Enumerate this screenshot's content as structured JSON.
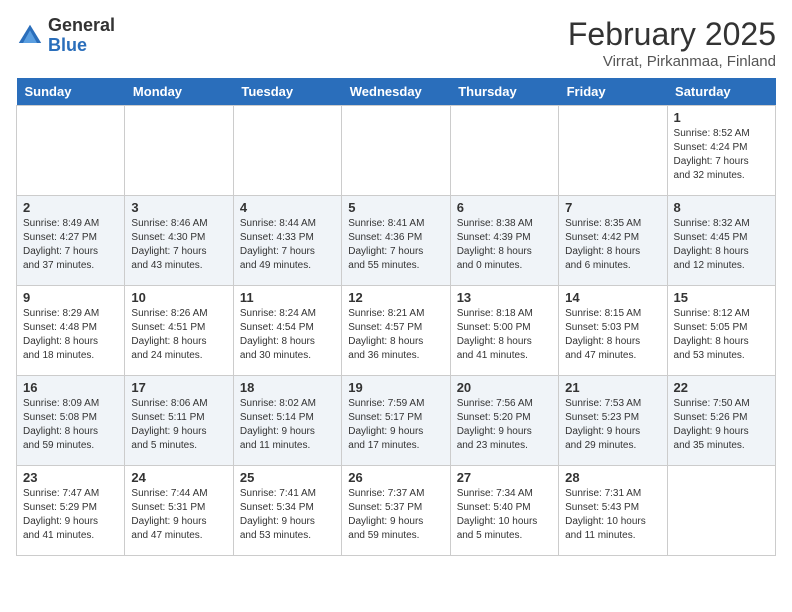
{
  "header": {
    "logo_general": "General",
    "logo_blue": "Blue",
    "title": "February 2025",
    "subtitle": "Virrat, Pirkanmaa, Finland"
  },
  "days_of_week": [
    "Sunday",
    "Monday",
    "Tuesday",
    "Wednesday",
    "Thursday",
    "Friday",
    "Saturday"
  ],
  "weeks": [
    [
      {
        "day": "",
        "info": ""
      },
      {
        "day": "",
        "info": ""
      },
      {
        "day": "",
        "info": ""
      },
      {
        "day": "",
        "info": ""
      },
      {
        "day": "",
        "info": ""
      },
      {
        "day": "",
        "info": ""
      },
      {
        "day": "1",
        "info": "Sunrise: 8:52 AM\nSunset: 4:24 PM\nDaylight: 7 hours\nand 32 minutes."
      }
    ],
    [
      {
        "day": "2",
        "info": "Sunrise: 8:49 AM\nSunset: 4:27 PM\nDaylight: 7 hours\nand 37 minutes."
      },
      {
        "day": "3",
        "info": "Sunrise: 8:46 AM\nSunset: 4:30 PM\nDaylight: 7 hours\nand 43 minutes."
      },
      {
        "day": "4",
        "info": "Sunrise: 8:44 AM\nSunset: 4:33 PM\nDaylight: 7 hours\nand 49 minutes."
      },
      {
        "day": "5",
        "info": "Sunrise: 8:41 AM\nSunset: 4:36 PM\nDaylight: 7 hours\nand 55 minutes."
      },
      {
        "day": "6",
        "info": "Sunrise: 8:38 AM\nSunset: 4:39 PM\nDaylight: 8 hours\nand 0 minutes."
      },
      {
        "day": "7",
        "info": "Sunrise: 8:35 AM\nSunset: 4:42 PM\nDaylight: 8 hours\nand 6 minutes."
      },
      {
        "day": "8",
        "info": "Sunrise: 8:32 AM\nSunset: 4:45 PM\nDaylight: 8 hours\nand 12 minutes."
      }
    ],
    [
      {
        "day": "9",
        "info": "Sunrise: 8:29 AM\nSunset: 4:48 PM\nDaylight: 8 hours\nand 18 minutes."
      },
      {
        "day": "10",
        "info": "Sunrise: 8:26 AM\nSunset: 4:51 PM\nDaylight: 8 hours\nand 24 minutes."
      },
      {
        "day": "11",
        "info": "Sunrise: 8:24 AM\nSunset: 4:54 PM\nDaylight: 8 hours\nand 30 minutes."
      },
      {
        "day": "12",
        "info": "Sunrise: 8:21 AM\nSunset: 4:57 PM\nDaylight: 8 hours\nand 36 minutes."
      },
      {
        "day": "13",
        "info": "Sunrise: 8:18 AM\nSunset: 5:00 PM\nDaylight: 8 hours\nand 41 minutes."
      },
      {
        "day": "14",
        "info": "Sunrise: 8:15 AM\nSunset: 5:03 PM\nDaylight: 8 hours\nand 47 minutes."
      },
      {
        "day": "15",
        "info": "Sunrise: 8:12 AM\nSunset: 5:05 PM\nDaylight: 8 hours\nand 53 minutes."
      }
    ],
    [
      {
        "day": "16",
        "info": "Sunrise: 8:09 AM\nSunset: 5:08 PM\nDaylight: 8 hours\nand 59 minutes."
      },
      {
        "day": "17",
        "info": "Sunrise: 8:06 AM\nSunset: 5:11 PM\nDaylight: 9 hours\nand 5 minutes."
      },
      {
        "day": "18",
        "info": "Sunrise: 8:02 AM\nSunset: 5:14 PM\nDaylight: 9 hours\nand 11 minutes."
      },
      {
        "day": "19",
        "info": "Sunrise: 7:59 AM\nSunset: 5:17 PM\nDaylight: 9 hours\nand 17 minutes."
      },
      {
        "day": "20",
        "info": "Sunrise: 7:56 AM\nSunset: 5:20 PM\nDaylight: 9 hours\nand 23 minutes."
      },
      {
        "day": "21",
        "info": "Sunrise: 7:53 AM\nSunset: 5:23 PM\nDaylight: 9 hours\nand 29 minutes."
      },
      {
        "day": "22",
        "info": "Sunrise: 7:50 AM\nSunset: 5:26 PM\nDaylight: 9 hours\nand 35 minutes."
      }
    ],
    [
      {
        "day": "23",
        "info": "Sunrise: 7:47 AM\nSunset: 5:29 PM\nDaylight: 9 hours\nand 41 minutes."
      },
      {
        "day": "24",
        "info": "Sunrise: 7:44 AM\nSunset: 5:31 PM\nDaylight: 9 hours\nand 47 minutes."
      },
      {
        "day": "25",
        "info": "Sunrise: 7:41 AM\nSunset: 5:34 PM\nDaylight: 9 hours\nand 53 minutes."
      },
      {
        "day": "26",
        "info": "Sunrise: 7:37 AM\nSunset: 5:37 PM\nDaylight: 9 hours\nand 59 minutes."
      },
      {
        "day": "27",
        "info": "Sunrise: 7:34 AM\nSunset: 5:40 PM\nDaylight: 10 hours\nand 5 minutes."
      },
      {
        "day": "28",
        "info": "Sunrise: 7:31 AM\nSunset: 5:43 PM\nDaylight: 10 hours\nand 11 minutes."
      },
      {
        "day": "",
        "info": ""
      }
    ]
  ]
}
